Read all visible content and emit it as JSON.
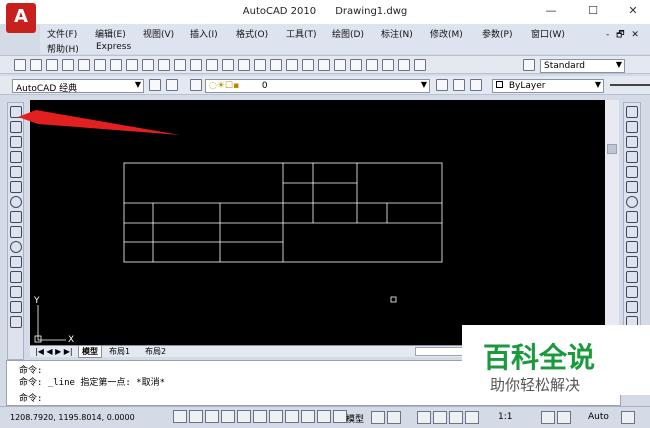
{
  "window": {
    "title_app": "AutoCAD 2010",
    "title_doc": "Drawing1.dwg",
    "minimize": "—",
    "maximize": "☐",
    "close": "✕",
    "app_letter": "A"
  },
  "menu": {
    "row1": [
      "文件(F)",
      "编辑(E)",
      "视图(V)",
      "插入(I)",
      "格式(O)",
      "工具(T)",
      "绘图(D)",
      "标注(N)",
      "修改(M)",
      "参数(P)",
      "窗口(W)"
    ],
    "row2": [
      "帮助(H)",
      "Express"
    ],
    "doc_controls": "- 🗗 ✕"
  },
  "toolbar1": {
    "text_style": "Standard"
  },
  "toolbar2": {
    "workspace": "AutoCAD 经典",
    "layer": "0",
    "color": "ByLayer"
  },
  "canvas": {
    "ucs_y": "Y",
    "ucs_x": "X"
  },
  "tabs": {
    "nav": "|◀ ◀ ▶ ▶|",
    "model": "模型",
    "layout1": "布局1",
    "layout2": "布局2"
  },
  "command": {
    "line1": "命令:",
    "line2": "命令: _line 指定第一点: *取消*",
    "line3": "命令:"
  },
  "status": {
    "coords": "1208.7920, 1195.8014, 0.0000",
    "model_label": "模型",
    "scale": "1:1",
    "auto": "Auto"
  },
  "watermark": {
    "title": "百科全说",
    "subtitle": "助你轻松解决"
  },
  "colors": {
    "app_red": "#c8201d",
    "arrow_red": "#e1201f",
    "canvas_bg": "#000000",
    "watermark_green": "#1a9a3c"
  }
}
